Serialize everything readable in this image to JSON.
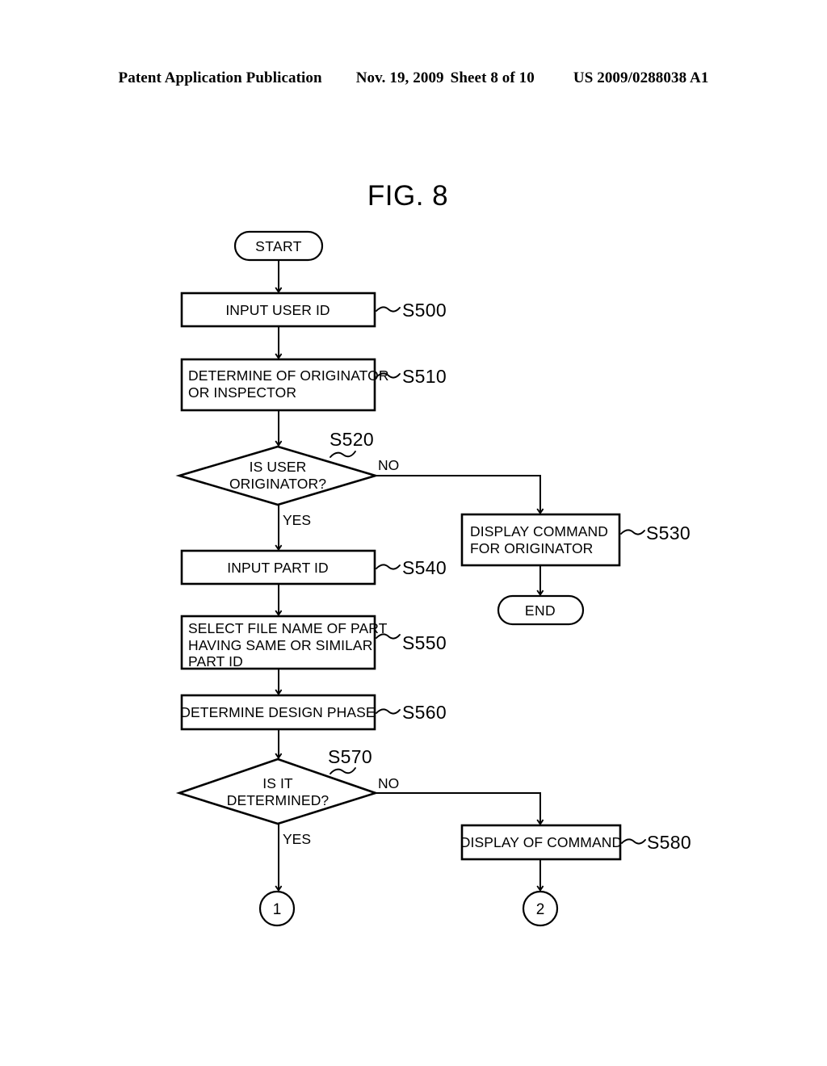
{
  "header": {
    "publication": "Patent Application Publication",
    "date": "Nov. 19, 2009",
    "sheet": "Sheet 8 of 10",
    "patent_number": "US 2009/0288038 A1"
  },
  "figure": {
    "title": "FIG. 8"
  },
  "nodes": {
    "start": {
      "label": "START"
    },
    "s500": {
      "label": "INPUT USER ID",
      "step": "S500"
    },
    "s510": {
      "line1": "DETERMINE OF ORIGINATOR",
      "line2": "OR INSPECTOR",
      "step": "S510"
    },
    "s520": {
      "line1": "IS USER",
      "line2": "ORIGINATOR?",
      "step": "S520"
    },
    "s530": {
      "line1": "DISPLAY COMMAND",
      "line2": "FOR ORIGINATOR",
      "step": "S530"
    },
    "end": {
      "label": "END"
    },
    "s540": {
      "label": "INPUT PART ID",
      "step": "S540"
    },
    "s550": {
      "line1": "SELECT FILE NAME OF PART",
      "line2": "HAVING SAME OR SIMILAR",
      "line3": "PART ID",
      "step": "S550"
    },
    "s560": {
      "label": "DETERMINE DESIGN PHASE",
      "step": "S560"
    },
    "s570": {
      "line1": "IS IT",
      "line2": "DETERMINED?",
      "step": "S570"
    },
    "s580": {
      "label": "DISPLAY OF COMMAND",
      "step": "S580"
    },
    "connector1": {
      "label": "1"
    },
    "connector2": {
      "label": "2"
    }
  },
  "branches": {
    "s520_no": "NO",
    "s520_yes": "YES",
    "s570_no": "NO",
    "s570_yes": "YES"
  },
  "colors": {
    "ink": "#000000",
    "paper": "#ffffff"
  }
}
